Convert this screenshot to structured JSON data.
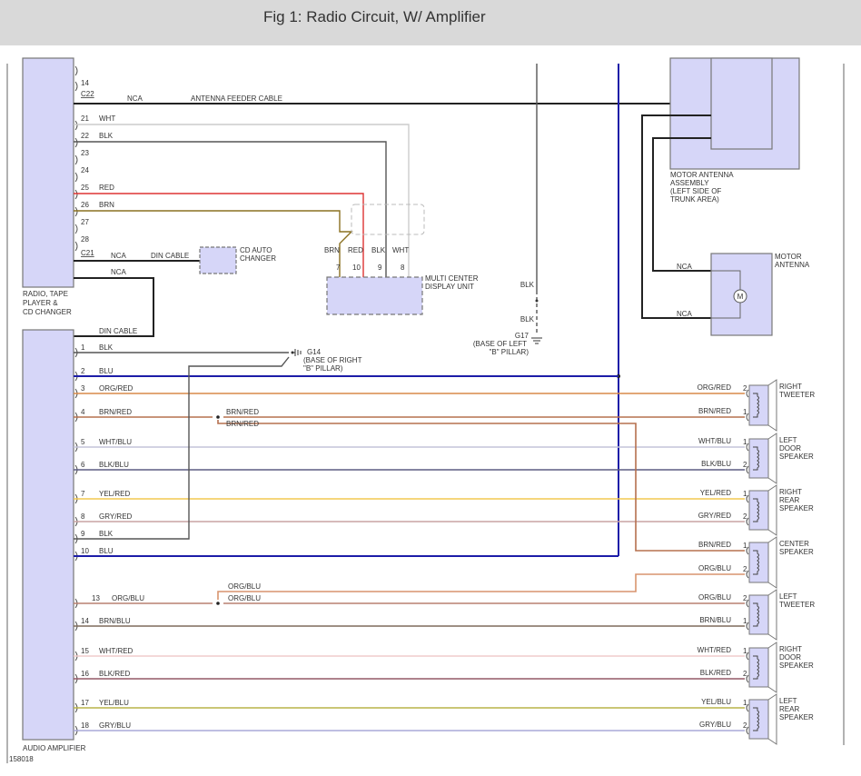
{
  "header": {
    "title": "Fig 1: Radio Circuit, W/ Amplifier"
  },
  "colors": {
    "component_fill": "#d6d6f8",
    "wire_blu": "#1c1ca8",
    "wire_blk": "#222222",
    "wire_gray": "#555555"
  },
  "radio": {
    "label": [
      "RADIO, TAPE",
      "PLAYER &",
      "CD CHANGER"
    ],
    "connector_c22": "C22",
    "connector_c21": "C21",
    "pins_top": [
      "14"
    ],
    "antenna": {
      "nca": "NCA",
      "label": "ANTENNA FEEDER CABLE"
    },
    "pins": [
      {
        "num": "21",
        "color": "WHT"
      },
      {
        "num": "22",
        "color": "BLK"
      },
      {
        "num": "23",
        "color": ""
      },
      {
        "num": "24",
        "color": ""
      },
      {
        "num": "25",
        "color": "RED"
      },
      {
        "num": "26",
        "color": "BRN"
      },
      {
        "num": "27",
        "color": ""
      },
      {
        "num": "28",
        "color": ""
      }
    ],
    "din1": {
      "nca": "NCA",
      "label": "DIN CABLE"
    },
    "din2": {
      "nca": "NCA",
      "label": "DIN CABLE"
    }
  },
  "cd_changer": {
    "label": [
      "CD AUTO",
      "CHANGER"
    ]
  },
  "display_unit": {
    "label": [
      "MULTI CENTER",
      "DISPLAY UNIT"
    ],
    "wires": [
      {
        "color": "BRN",
        "pin": "7"
      },
      {
        "color": "RED",
        "pin": "10"
      },
      {
        "color": "BLK",
        "pin": "9"
      },
      {
        "color": "WHT",
        "pin": "8"
      }
    ]
  },
  "ground_g17": {
    "wire1": "BLK",
    "wire2": "BLK",
    "label": [
      "G17",
      "(BASE OF LEFT",
      "\"B\" PILLAR)"
    ]
  },
  "ground_g14": {
    "label": [
      "G14",
      "(BASE OF RIGHT",
      "\"B\" PILLAR)"
    ]
  },
  "motor_antenna_assembly": {
    "label": [
      "MOTOR ANTENNA",
      "ASSEMBLY",
      "(LEFT SIDE OF",
      "TRUNK AREA)"
    ]
  },
  "motor_antenna": {
    "label": [
      "MOTOR",
      "ANTENNA"
    ],
    "wire1": "NCA",
    "wire2": "NCA",
    "motor_symbol": "M"
  },
  "amplifier": {
    "label": "AUDIO AMPLIFIER",
    "pins": [
      {
        "num": "1",
        "color": "BLK",
        "hex": "#555555"
      },
      {
        "num": "2",
        "color": "BLU",
        "hex": "#1c1ca8"
      },
      {
        "num": "3",
        "color": "ORG/RED",
        "hex": "#d88a48"
      },
      {
        "num": "4",
        "color": "BRN/RED",
        "hex": "#b5704e"
      },
      {
        "num": "5",
        "color": "WHT/BLU",
        "hex": "#c4c4d8"
      },
      {
        "num": "6",
        "color": "BLK/BLU",
        "hex": "#5c5c82"
      },
      {
        "num": "7",
        "color": "YEL/RED",
        "hex": "#f2c850"
      },
      {
        "num": "8",
        "color": "GRY/RED",
        "hex": "#c8a4a4"
      },
      {
        "num": "9",
        "color": "BLK",
        "hex": "#555555"
      },
      {
        "num": "10",
        "color": "BLU",
        "hex": "#1c1ca8"
      },
      {
        "num": "13",
        "color": "ORG/BLU",
        "hex": "#b88070"
      },
      {
        "num": "14",
        "color": "BRN/BLU",
        "hex": "#7e6c5c"
      },
      {
        "num": "15",
        "color": "WHT/RED",
        "hex": "#f0cccc"
      },
      {
        "num": "16",
        "color": "BLK/RED",
        "hex": "#945866"
      },
      {
        "num": "17",
        "color": "YEL/BLU",
        "hex": "#b8b448"
      },
      {
        "num": "18",
        "color": "GRY/BLU",
        "hex": "#a8a8d8"
      }
    ],
    "splice_labels": {
      "brn_red_a": "BRN/RED",
      "brn_red_b": "BRN/RED",
      "org_blu_a": "ORG/BLU",
      "org_blu_b": "ORG/BLU"
    }
  },
  "speakers": [
    {
      "label": [
        "RIGHT",
        "TWEETER"
      ],
      "wires": [
        {
          "color": "ORG/RED",
          "pin": "2",
          "hex": "#d88a48"
        },
        {
          "color": "BRN/RED",
          "pin": "1",
          "hex": "#b5704e"
        }
      ]
    },
    {
      "label": [
        "LEFT",
        "DOOR",
        "SPEAKER"
      ],
      "wires": [
        {
          "color": "WHT/BLU",
          "pin": "1",
          "hex": "#c4c4d8"
        },
        {
          "color": "BLK/BLU",
          "pin": "2",
          "hex": "#5c5c82"
        }
      ]
    },
    {
      "label": [
        "RIGHT",
        "REAR",
        "SPEAKER"
      ],
      "wires": [
        {
          "color": "YEL/RED",
          "pin": "1",
          "hex": "#f2c850"
        },
        {
          "color": "GRY/RED",
          "pin": "2",
          "hex": "#c8a4a4"
        }
      ]
    },
    {
      "label": [
        "CENTER",
        "SPEAKER"
      ],
      "wires": [
        {
          "color": "BRN/RED",
          "pin": "1",
          "hex": "#b5704e"
        },
        {
          "color": "ORG/BLU",
          "pin": "2",
          "hex": "#b88070"
        }
      ]
    },
    {
      "label": [
        "LEFT",
        "TWEETER"
      ],
      "wires": [
        {
          "color": "ORG/BLU",
          "pin": "2",
          "hex": "#b88070"
        },
        {
          "color": "BRN/BLU",
          "pin": "1",
          "hex": "#7e6c5c"
        }
      ]
    },
    {
      "label": [
        "RIGHT",
        "DOOR",
        "SPEAKER"
      ],
      "wires": [
        {
          "color": "WHT/RED",
          "pin": "1",
          "hex": "#f0cccc"
        },
        {
          "color": "BLK/RED",
          "pin": "2",
          "hex": "#945866"
        }
      ]
    },
    {
      "label": [
        "LEFT",
        "REAR",
        "SPEAKER"
      ],
      "wires": [
        {
          "color": "YEL/BLU",
          "pin": "1",
          "hex": "#b8b448"
        },
        {
          "color": "GRY/BLU",
          "pin": "2",
          "hex": "#a8a8d8"
        }
      ]
    }
  ],
  "figure_id": "158018"
}
